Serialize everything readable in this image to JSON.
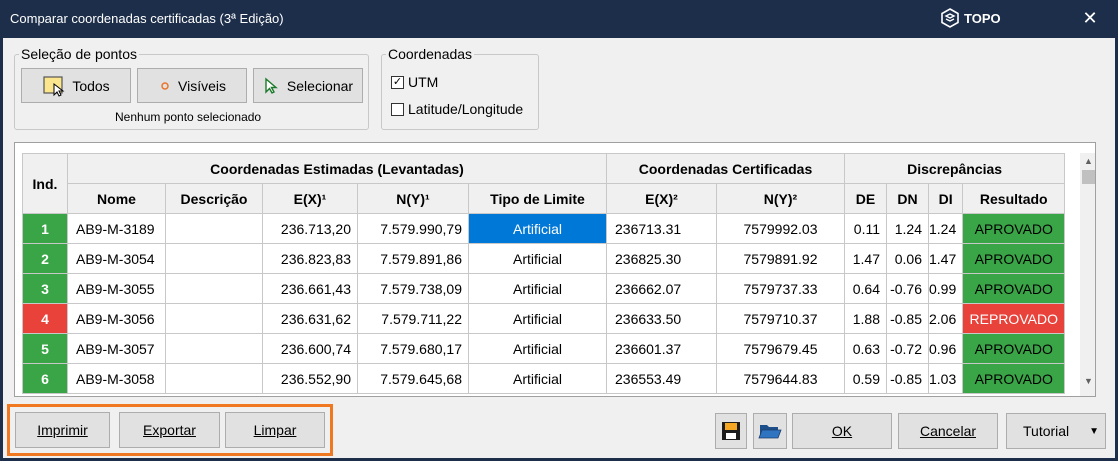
{
  "window": {
    "title": "Comparar coordenadas certificadas (3ª Edição)",
    "brand": "TOPO",
    "close_glyph": "✕"
  },
  "selecao": {
    "legend": "Seleção de pontos",
    "todos": "Todos",
    "visiveis": "Visíveis",
    "selecionar": "Selecionar",
    "status": "Nenhum ponto selecionado"
  },
  "coordenadas": {
    "legend": "Coordenadas",
    "utm": {
      "label": "UTM",
      "checked": true
    },
    "latlon": {
      "label": "Latitude/Longitude",
      "checked": false
    }
  },
  "grid": {
    "groups": {
      "ind": "Ind.",
      "estimadas": "Coordenadas Estimadas (Levantadas)",
      "certificadas": "Coordenadas Certificadas",
      "discrepancias": "Discrepâncias"
    },
    "columns": [
      "Nome",
      "Descrição",
      "E(X)¹",
      "N(Y)¹",
      "Tipo de Limite",
      "E(X)²",
      "N(Y)²",
      "DE",
      "DN",
      "DI",
      "Resultado"
    ],
    "colors": {
      "approved": "#3aa547",
      "rejected": "#e8423a"
    },
    "rows": [
      {
        "ind": "1",
        "nome": "AB9-M-3189",
        "descricao": "",
        "ex1": "236.713,20",
        "ny1": "7.579.990,79",
        "tipo": "Artificial",
        "ex2": "236713.31",
        "ny2": "7579992.03",
        "de": "0.11",
        "dn": "1.24",
        "di": "1.24",
        "resultado": "APROVADO",
        "status": "approved"
      },
      {
        "ind": "2",
        "nome": "AB9-M-3054",
        "descricao": "",
        "ex1": "236.823,83",
        "ny1": "7.579.891,86",
        "tipo": "Artificial",
        "ex2": "236825.30",
        "ny2": "7579891.92",
        "de": "1.47",
        "dn": "0.06",
        "di": "1.47",
        "resultado": "APROVADO",
        "status": "approved"
      },
      {
        "ind": "3",
        "nome": "AB9-M-3055",
        "descricao": "",
        "ex1": "236.661,43",
        "ny1": "7.579.738,09",
        "tipo": "Artificial",
        "ex2": "236662.07",
        "ny2": "7579737.33",
        "de": "0.64",
        "dn": "-0.76",
        "di": "0.99",
        "resultado": "APROVADO",
        "status": "approved"
      },
      {
        "ind": "4",
        "nome": "AB9-M-3056",
        "descricao": "",
        "ex1": "236.631,62",
        "ny1": "7.579.711,22",
        "tipo": "Artificial",
        "ex2": "236633.50",
        "ny2": "7579710.37",
        "de": "1.88",
        "dn": "-0.85",
        "di": "2.06",
        "resultado": "REPROVADO",
        "status": "rejected"
      },
      {
        "ind": "5",
        "nome": "AB9-M-3057",
        "descricao": "",
        "ex1": "236.600,74",
        "ny1": "7.579.680,17",
        "tipo": "Artificial",
        "ex2": "236601.37",
        "ny2": "7579679.45",
        "de": "0.63",
        "dn": "-0.72",
        "di": "0.96",
        "resultado": "APROVADO",
        "status": "approved"
      },
      {
        "ind": "6",
        "nome": "AB9-M-3058",
        "descricao": "",
        "ex1": "236.552,90",
        "ny1": "7.579.645,68",
        "tipo": "Artificial",
        "ex2": "236553.49",
        "ny2": "7579644.83",
        "de": "0.59",
        "dn": "-0.85",
        "di": "1.03",
        "resultado": "APROVADO",
        "status": "approved"
      }
    ]
  },
  "footer": {
    "imprimir": "Imprimir",
    "exportar": "Exportar",
    "limpar": "Limpar",
    "ok": "OK",
    "cancelar": "Cancelar",
    "tutorial": "Tutorial"
  },
  "icons": {
    "todos": "select-all-icon",
    "visiveis": "visible-point-icon",
    "selecionar": "cursor-select-icon",
    "save": "save-icon",
    "open": "open-folder-icon"
  }
}
